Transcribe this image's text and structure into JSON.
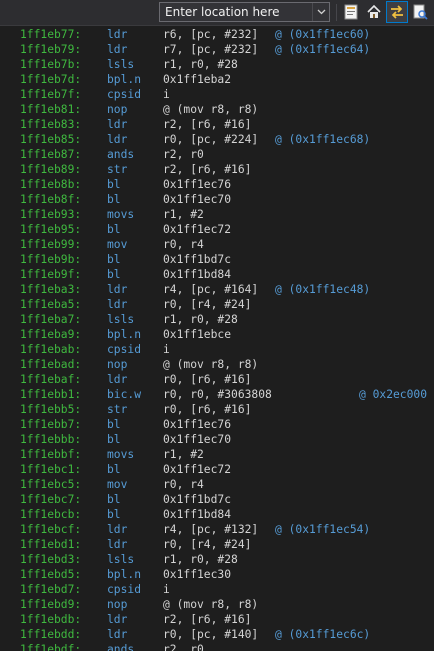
{
  "toolbar": {
    "location_placeholder": "Enter location here",
    "buttons": [
      {
        "icon": "listing-view-icon"
      },
      {
        "icon": "home-icon"
      },
      {
        "icon": "swap-arrows-icon"
      },
      {
        "icon": "document-search-icon"
      }
    ]
  },
  "colors": {
    "background": "#1e1e1e",
    "address": "#3fb83f",
    "mnemonic": "#569cd6",
    "operands": "#d4d4d4",
    "comment": "#569cd6"
  },
  "listing": [
    {
      "addr": "1ff1eb77:",
      "mn": "ldr",
      "ops": "r6, [pc, #232]",
      "cmt": "@ (0x1ff1ec60)"
    },
    {
      "addr": "1ff1eb79:",
      "mn": "ldr",
      "ops": "r7, [pc, #232]",
      "cmt": "@ (0x1ff1ec64)"
    },
    {
      "addr": "1ff1eb7b:",
      "mn": "lsls",
      "ops": "r1, r0, #28",
      "cmt": ""
    },
    {
      "addr": "1ff1eb7d:",
      "mn": "bpl.n",
      "ops": "0x1ff1eba2",
      "cmt": ""
    },
    {
      "addr": "1ff1eb7f:",
      "mn": "cpsid",
      "ops": "i",
      "cmt": ""
    },
    {
      "addr": "1ff1eb81:",
      "mn": "nop",
      "ops": "@ (mov r8, r8)",
      "cmt": ""
    },
    {
      "addr": "1ff1eb83:",
      "mn": "ldr",
      "ops": "r2, [r6, #16]",
      "cmt": ""
    },
    {
      "addr": "1ff1eb85:",
      "mn": "ldr",
      "ops": "r0, [pc, #224]",
      "cmt": "@ (0x1ff1ec68)"
    },
    {
      "addr": "1ff1eb87:",
      "mn": "ands",
      "ops": "r2, r0",
      "cmt": ""
    },
    {
      "addr": "1ff1eb89:",
      "mn": "str",
      "ops": "r2, [r6, #16]",
      "cmt": ""
    },
    {
      "addr": "1ff1eb8b:",
      "mn": "bl",
      "ops": "0x1ff1ec76",
      "cmt": ""
    },
    {
      "addr": "1ff1eb8f:",
      "mn": "bl",
      "ops": "0x1ff1ec70",
      "cmt": ""
    },
    {
      "addr": "1ff1eb93:",
      "mn": "movs",
      "ops": "r1, #2",
      "cmt": ""
    },
    {
      "addr": "1ff1eb95:",
      "mn": "bl",
      "ops": "0x1ff1ec72",
      "cmt": ""
    },
    {
      "addr": "1ff1eb99:",
      "mn": "mov",
      "ops": "r0, r4",
      "cmt": ""
    },
    {
      "addr": "1ff1eb9b:",
      "mn": "bl",
      "ops": "0x1ff1bd7c",
      "cmt": ""
    },
    {
      "addr": "1ff1eb9f:",
      "mn": "bl",
      "ops": "0x1ff1bd84",
      "cmt": ""
    },
    {
      "addr": "1ff1eba3:",
      "mn": "ldr",
      "ops": "r4, [pc, #164]",
      "cmt": "@ (0x1ff1ec48)"
    },
    {
      "addr": "1ff1eba5:",
      "mn": "ldr",
      "ops": "r0, [r4, #24]",
      "cmt": ""
    },
    {
      "addr": "1ff1eba7:",
      "mn": "lsls",
      "ops": "r1, r0, #28",
      "cmt": ""
    },
    {
      "addr": "1ff1eba9:",
      "mn": "bpl.n",
      "ops": "0x1ff1ebce",
      "cmt": ""
    },
    {
      "addr": "1ff1ebab:",
      "mn": "cpsid",
      "ops": "i",
      "cmt": ""
    },
    {
      "addr": "1ff1ebad:",
      "mn": "nop",
      "ops": "@ (mov r8, r8)",
      "cmt": ""
    },
    {
      "addr": "1ff1ebaf:",
      "mn": "ldr",
      "ops": "r0, [r6, #16]",
      "cmt": ""
    },
    {
      "addr": "1ff1ebb1:",
      "mn": "bic.w",
      "ops": "r0, r0, #3063808",
      "cmt": "@ 0x2ec000",
      "far": true
    },
    {
      "addr": "1ff1ebb5:",
      "mn": "str",
      "ops": "r0, [r6, #16]",
      "cmt": ""
    },
    {
      "addr": "1ff1ebb7:",
      "mn": "bl",
      "ops": "0x1ff1ec76",
      "cmt": ""
    },
    {
      "addr": "1ff1ebbb:",
      "mn": "bl",
      "ops": "0x1ff1ec70",
      "cmt": ""
    },
    {
      "addr": "1ff1ebbf:",
      "mn": "movs",
      "ops": "r1, #2",
      "cmt": ""
    },
    {
      "addr": "1ff1ebc1:",
      "mn": "bl",
      "ops": "0x1ff1ec72",
      "cmt": ""
    },
    {
      "addr": "1ff1ebc5:",
      "mn": "mov",
      "ops": "r0, r4",
      "cmt": ""
    },
    {
      "addr": "1ff1ebc7:",
      "mn": "bl",
      "ops": "0x1ff1bd7c",
      "cmt": ""
    },
    {
      "addr": "1ff1ebcb:",
      "mn": "bl",
      "ops": "0x1ff1bd84",
      "cmt": ""
    },
    {
      "addr": "1ff1ebcf:",
      "mn": "ldr",
      "ops": "r4, [pc, #132]",
      "cmt": "@ (0x1ff1ec54)"
    },
    {
      "addr": "1ff1ebd1:",
      "mn": "ldr",
      "ops": "r0, [r4, #24]",
      "cmt": ""
    },
    {
      "addr": "1ff1ebd3:",
      "mn": "lsls",
      "ops": "r1, r0, #28",
      "cmt": ""
    },
    {
      "addr": "1ff1ebd5:",
      "mn": "bpl.n",
      "ops": "0x1ff1ec30",
      "cmt": ""
    },
    {
      "addr": "1ff1ebd7:",
      "mn": "cpsid",
      "ops": "i",
      "cmt": ""
    },
    {
      "addr": "1ff1ebd9:",
      "mn": "nop",
      "ops": "@ (mov r8, r8)",
      "cmt": ""
    },
    {
      "addr": "1ff1ebdb:",
      "mn": "ldr",
      "ops": "r2, [r6, #16]",
      "cmt": ""
    },
    {
      "addr": "1ff1ebdd:",
      "mn": "ldr",
      "ops": "r0, [pc, #140]",
      "cmt": "@ (0x1ff1ec6c)"
    },
    {
      "addr": "1ff1ebdf:",
      "mn": "ands",
      "ops": "r2, r0",
      "cmt": ""
    }
  ]
}
